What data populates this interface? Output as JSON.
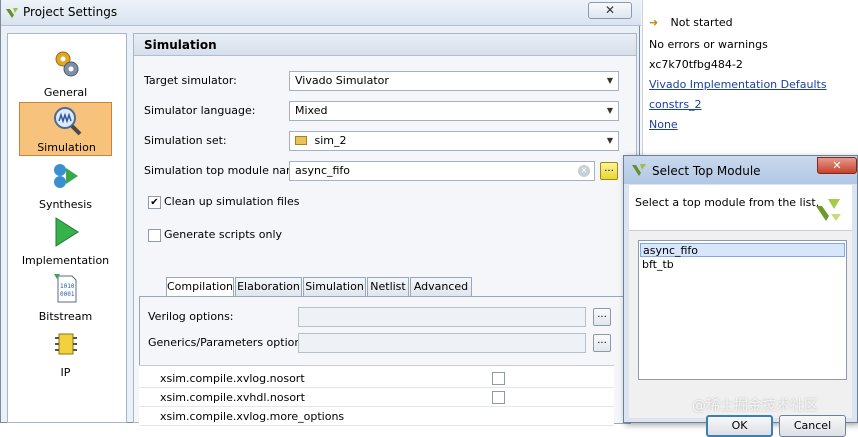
{
  "project_settings": {
    "title": "Project Settings",
    "close_label": "✕",
    "nav": [
      {
        "label": "General",
        "icon": "gear-icon"
      },
      {
        "label": "Simulation",
        "icon": "magnifier-waveform-icon"
      },
      {
        "label": "Synthesis",
        "icon": "synthesis-icon"
      },
      {
        "label": "Implementation",
        "icon": "play-arrow-icon"
      },
      {
        "label": "Bitstream",
        "icon": "binary-file-icon"
      },
      {
        "label": "IP",
        "icon": "ip-chip-icon"
      }
    ],
    "selected_nav": "Simulation",
    "section_title": "Simulation",
    "target_simulator": {
      "label": "Target simulator:",
      "value": "Vivado Simulator"
    },
    "simulator_language": {
      "label": "Simulator language:",
      "value": "Mixed"
    },
    "simulation_set": {
      "label": "Simulation set:",
      "value": "sim_2"
    },
    "top_module": {
      "label": "Simulation top module name:",
      "value": "async_fifo"
    },
    "browse_label": "...",
    "cleanup": {
      "label": "Clean up simulation files",
      "checked": true
    },
    "gen_scripts": {
      "label": "Generate scripts only",
      "checked": false
    },
    "tabs": [
      "Compilation",
      "Elaboration",
      "Simulation",
      "Netlist",
      "Advanced"
    ],
    "active_tab": "Compilation",
    "verilog_options": {
      "label": "Verilog options:",
      "value": ""
    },
    "generics_options": {
      "label": "Generics/Parameters options:",
      "value": ""
    },
    "options_table": [
      {
        "name": "xsim.compile.xvlog.nosort",
        "checked": false
      },
      {
        "name": "xsim.compile.xvhdl.nosort",
        "checked": false
      },
      {
        "name": "xsim.compile.xvlog.more_options",
        "checked": null
      }
    ]
  },
  "background": {
    "status": "Not started",
    "messages": "No errors or warnings",
    "part": "xc7k70tfbg484-2",
    "strategy_link": "Vivado Implementation Defaults",
    "constraints_link": "constrs_2",
    "none_link": "None"
  },
  "select_top_module": {
    "title": "Select Top Module",
    "close_label": "✕",
    "instruction": "Select a top module from the list.",
    "modules": [
      "async_fifo",
      "bft_tb"
    ],
    "selected": "async_fifo",
    "ok_label": "OK",
    "cancel_label": "Cancel"
  },
  "watermark": "@稀土掘金技术社区"
}
